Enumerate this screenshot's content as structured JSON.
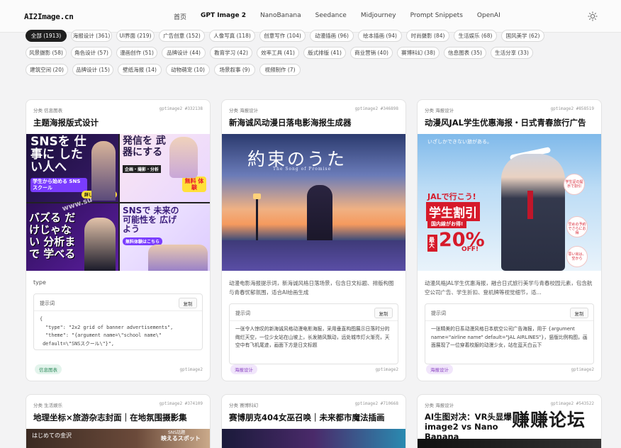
{
  "header": {
    "logo": "AI2Image.cn",
    "nav": [
      "首页",
      "GPT Image 2",
      "NanoBanana",
      "Seedance",
      "Midjourney",
      "Prompt Snippets",
      "OpenAI"
    ],
    "active_nav": "GPT Image 2",
    "theme_icon": "sun-icon"
  },
  "filters": {
    "rows": [
      [
        "全部 (1913)",
        "海报设计 (361)",
        "UI界面 (219)",
        "广告创意 (152)",
        "人像写真 (118)",
        "创意写作 (104)",
        "动漫插画 (96)",
        "绘本插画 (94)",
        "时尚摄影 (84)",
        "生活娱乐 (68)",
        "国风美学 (62)"
      ],
      [
        "风景摄影 (58)",
        "角色设计 (57)",
        "漫画创作 (51)",
        "品牌设计 (44)",
        "教育学习 (42)",
        "效率工具 (41)",
        "版式排版 (41)",
        "商业营销 (40)",
        "赛博科幻 (38)",
        "信息图表 (35)",
        "生活分享 (33)"
      ],
      [
        "建筑空间 (20)",
        "品牌设计 (15)",
        "壁纸海报 (14)",
        "动物萌宠 (10)",
        "场景叙事 (9)",
        "视频制作 (7)"
      ]
    ],
    "active": "全部 (1913)"
  },
  "cards": [
    {
      "category": "分类 信息图表",
      "id": "gptimage2 #332138",
      "title": "主题海报版式设计",
      "type_label": "type",
      "prompt_label": "提示词",
      "copy_label": "复制",
      "prompt_text": "{\n  \"type\": \"2x2 grid of banner advertisements\",\n  \"theme\": \"{argument name=\\\"school name\\\"\n default=\\\"SNSスクール\\\"}\",",
      "tag": "信息图表",
      "model": "gptimage2",
      "overlay": {
        "q1": "SNSを 仕事に したい人へ",
        "q1_sub": "学生から始める SNSスクール",
        "q1_badge": "詳しくはこちら",
        "q2": "発信を 武器にする",
        "q2_sub": "企画・撮影・分析",
        "q2_badge": "無料 体験",
        "q3": "バズる だけじゃない 分析まで 学べる",
        "q4": "SNSで 未来の可能性を 広げよう",
        "q4_badge": "無料体験はこちら",
        "watermark": "www.su"
      }
    },
    {
      "category": "分类 海报设计",
      "id": "gptimage2 #346898",
      "title": "新海诚风动漫日落电影海报生成器",
      "description": "动漫电影海报提示词，新海诚风格日落场景，包含日文标题、排版构图与青春忧郁氛围，适合AI绘画生成",
      "prompt_label": "提示词",
      "copy_label": "复制",
      "prompt_text": "一张令人惊叹的新海诚风格动漫电影海报，采用垂直构图展示日落时分的绚烂天空，一位少女站在山坡上，长发随风飘动，远处城市灯火渐亮，天空中有飞机尾迹，画面下方是日文标题",
      "tag": "海报设计",
      "model": "gptimage2",
      "overlay": {
        "title_jp": "約束のうた",
        "subtitle": "The Song of Promise"
      }
    },
    {
      "category": "分类 海报设计",
      "id": "gptimage2 #858519",
      "title": "动漫风JAL学生优惠海报・日式青春旅行广告",
      "description": "动漫风格JAL学生优惠海报，融合日式旅行美学与青春校园元素，包含航空公司广告、学生折扣、登机牌等视觉细节，适...",
      "prompt_label": "提示词",
      "copy_label": "复制",
      "prompt_text": "一张精美的日系动漫风格日本航空公司广告海报，用于 {argument name=\"airline name\" default=\"JAL AIRLINES\"}，竖版比例构图，画面展现了一位穿着校服的动漫少女，站在蓝天白云下",
      "tag": "海报设计",
      "model": "gptimage2",
      "overlay": {
        "top": "いざしかできない旅がある。",
        "line1": "JALで行こう!",
        "line2": "学生割引",
        "line3": "国内線がお得!",
        "line4": "最大",
        "line5": "20%",
        "line6": "OFF!",
        "side1": "学生証の提示で割引",
        "side2": "早めの予約でさらにお得",
        "side3": "思い出は、空から"
      }
    },
    {
      "category": "分类 生活娱乐",
      "id": "gptimage2 #374109",
      "title": "地理坐标×旅游杂志封面｜在地氛围摄影集",
      "overlay": {
        "l1": "はじめての金沢",
        "l2": "SNS話題",
        "l3": "映えるスポット"
      }
    },
    {
      "category": "分类 赛博科幻",
      "id": "gptimage2 #710668",
      "title": "赛博朋克404女巫召唤｜未来都市魔法插画"
    },
    {
      "category": "分类 海报设计",
      "id": "gptimage2 #543522",
      "title": "AI生图对决：VR头显爆... image2 vs Nano Banana"
    }
  ],
  "watermark": "赚赚论坛",
  "colors": {
    "accent_dark": "#1f1f1f",
    "tag_green": "#2e8a5b",
    "tag_purple": "#8a44c2"
  }
}
